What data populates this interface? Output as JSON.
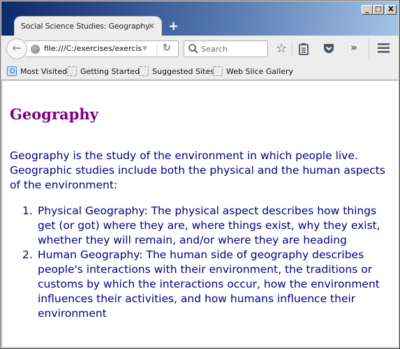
{
  "window": {
    "controls": {
      "minimize": "_",
      "maximize": "□",
      "close": "X"
    }
  },
  "tab": {
    "title": "Social Science Studies: Geography",
    "close_glyph": "×",
    "new_tab_glyph": "+"
  },
  "navbar": {
    "back_glyph": "←",
    "url": "file:///C:/exercises/exercise",
    "dropdown_glyph": "▼",
    "reload_glyph": "↻",
    "search_placeholder": "Search",
    "star_glyph": "☆",
    "overflow_glyph": "»"
  },
  "bookmarks": [
    {
      "label": "Most Visited",
      "icon": "most-visited-icon"
    },
    {
      "label": "Getting Started",
      "icon": "placeholder-icon"
    },
    {
      "label": "Suggested Sites",
      "icon": "placeholder-icon"
    },
    {
      "label": "Web Slice Gallery",
      "icon": "placeholder-icon"
    }
  ],
  "page": {
    "title": "Geography",
    "intro": "Geography is the study of the environment in which people live. Geographic studies include both the physical and the human aspects of the environment:",
    "items": [
      {
        "number": "1.",
        "text": "Physical Geography: The physical aspect describes how things get (or got) where they are, where things exist, why they exist, whether they will remain, and/or where they are heading"
      },
      {
        "number": "2.",
        "text": "Human Geography: The human side of geography describes people's interactions with their environment, the traditions or customs by which the interactions occur, how the environment influences their activities, and how humans influence their environment"
      }
    ]
  },
  "colors": {
    "heading": "#800080",
    "body_text": "#000080",
    "titlebar_start": "#0b2a6e",
    "titlebar_end": "#a6c4e6"
  }
}
